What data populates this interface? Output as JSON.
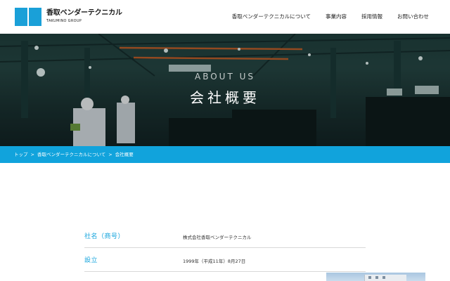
{
  "header": {
    "logo_title": "香取ベンダーテクニカル",
    "logo_subtitle": "TAKUMINO GROUP",
    "nav": [
      {
        "label": "香取ベンダーテクニカルについて"
      },
      {
        "label": "事業内容"
      },
      {
        "label": "採用情報"
      },
      {
        "label": "お問い合わせ"
      }
    ]
  },
  "hero": {
    "eyebrow": "ABOUT US",
    "title": "会社概要"
  },
  "breadcrumb": {
    "items": [
      {
        "label": "トップ"
      },
      {
        "label": "香取ベンダーテクニカルについて"
      },
      {
        "label": "会社概要"
      }
    ],
    "separator": ">"
  },
  "profile": {
    "rows": [
      {
        "label": "社名（商号）",
        "value": "株式会社香取ベンダーテクニカル"
      },
      {
        "label": "設立",
        "value": "1999年（平成11年）8月27日"
      }
    ]
  },
  "colors": {
    "brand": "#11a3dc",
    "logo": "#1aa0d8"
  }
}
